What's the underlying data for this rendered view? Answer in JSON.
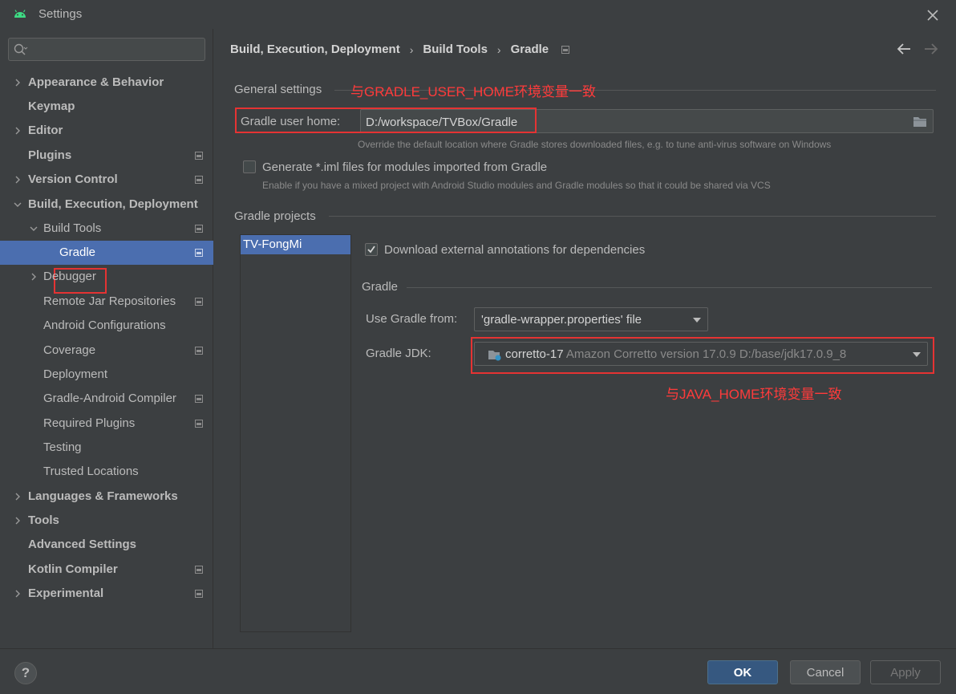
{
  "window": {
    "title": "Settings"
  },
  "search": {
    "placeholder": "",
    "value": ""
  },
  "sidebar": {
    "items": [
      {
        "label": "Appearance & Behavior"
      },
      {
        "label": "Keymap"
      },
      {
        "label": "Editor"
      },
      {
        "label": "Plugins"
      },
      {
        "label": "Version Control"
      },
      {
        "label": "Build, Execution, Deployment"
      },
      {
        "label": "Build Tools"
      },
      {
        "label": "Gradle"
      },
      {
        "label": "Debugger"
      },
      {
        "label": "Remote Jar Repositories"
      },
      {
        "label": "Android Configurations"
      },
      {
        "label": "Coverage"
      },
      {
        "label": "Deployment"
      },
      {
        "label": "Gradle-Android Compiler"
      },
      {
        "label": "Required Plugins"
      },
      {
        "label": "Testing"
      },
      {
        "label": "Trusted Locations"
      },
      {
        "label": "Languages & Frameworks"
      },
      {
        "label": "Tools"
      },
      {
        "label": "Advanced Settings"
      },
      {
        "label": "Kotlin Compiler"
      },
      {
        "label": "Experimental"
      }
    ]
  },
  "breadcrumb": {
    "items": [
      "Build, Execution, Deployment",
      "Build Tools",
      "Gradle"
    ],
    "separator": "›"
  },
  "general": {
    "title": "General settings",
    "annotation": "与GRADLE_USER_HOME环境变量一致",
    "user_home_label": "Gradle user home:",
    "user_home_value": "D:/workspace/TVBox/Gradle",
    "user_home_hint": "Override the default location where Gradle stores downloaded files, e.g. to tune anti-virus software on Windows",
    "iml_label": "Generate *.iml files for modules imported from Gradle",
    "iml_checked": false,
    "iml_hint": "Enable if you have a mixed project with Android Studio modules and Gradle modules so that it could be shared via VCS"
  },
  "projects": {
    "title": "Gradle projects",
    "list": [
      "TV-FongMi"
    ],
    "download_annotations_label": "Download external annotations for dependencies",
    "download_annotations_checked": true,
    "gradle_section_title": "Gradle",
    "use_gradle_from_label": "Use Gradle from:",
    "use_gradle_from_value": "'gradle-wrapper.properties' file",
    "jdk_label": "Gradle JDK:",
    "jdk_name": "corretto-17",
    "jdk_detail": "Amazon Corretto version 17.0.9 D:/base/jdk17.0.9_8",
    "jdk_annotation": "与JAVA_HOME环境变量一致"
  },
  "footer": {
    "help": "?",
    "ok": "OK",
    "cancel": "Cancel",
    "apply": "Apply"
  },
  "colors": {
    "background": "#3c3f41",
    "selection": "#4b6eaf",
    "annotation_red": "#ff3b3b",
    "ok_button": "#365880"
  }
}
